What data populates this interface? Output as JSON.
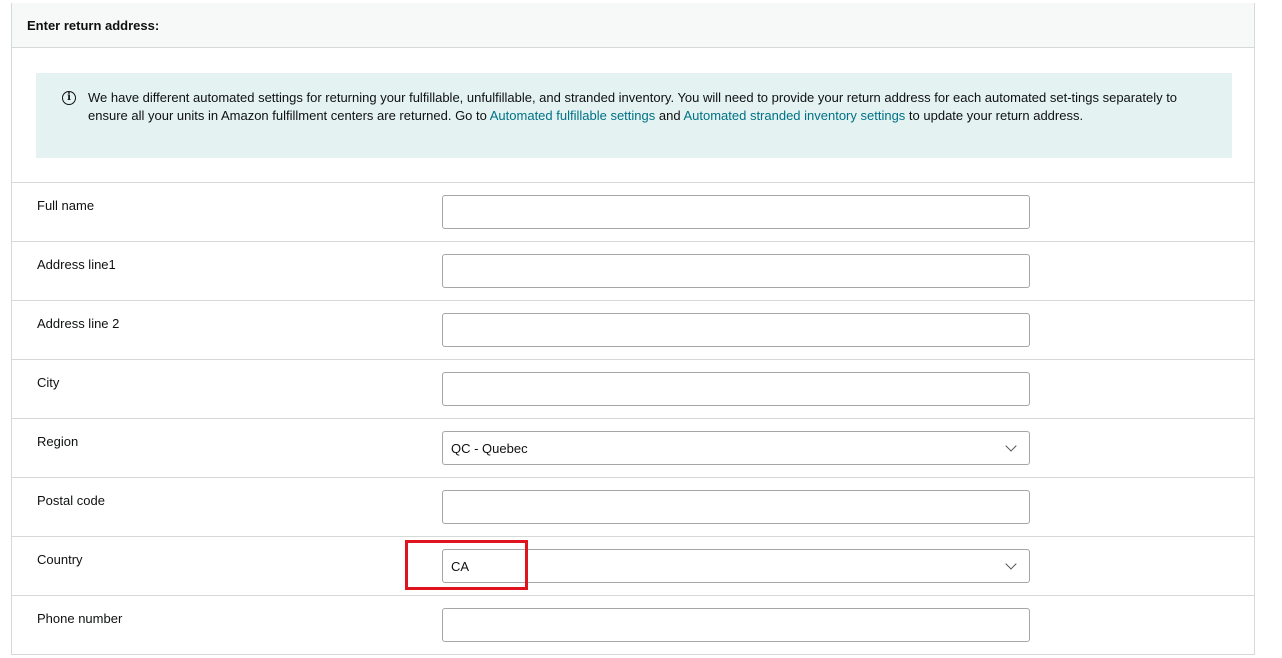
{
  "header": {
    "title": "Enter return address:"
  },
  "info": {
    "text_before": "We have different automated settings for returning your fulfillable, unfulfillable, and stranded inventory. You will need to provide your return address for each automated set-tings separately to ensure all your units in Amazon fulfillment centers are returned. Go to ",
    "link1": "Automated fulfillable settings",
    "text_mid": " and ",
    "link2": "Automated stranded inventory settings",
    "text_after": " to update your return address.",
    "icon": "info-icon"
  },
  "form": {
    "full_name": {
      "label": "Full name",
      "value": ""
    },
    "address_line1": {
      "label": "Address line1",
      "value": ""
    },
    "address_line2": {
      "label": "Address line 2",
      "value": ""
    },
    "city": {
      "label": "City",
      "value": ""
    },
    "region": {
      "label": "Region",
      "value": "QC - Quebec"
    },
    "postal_code": {
      "label": "Postal code",
      "value": ""
    },
    "country": {
      "label": "Country",
      "value": "CA"
    },
    "phone": {
      "label": "Phone number",
      "value": ""
    }
  },
  "colors": {
    "highlight": "#e0141e",
    "link": "#007185",
    "info_bg": "#e4f2f2"
  }
}
